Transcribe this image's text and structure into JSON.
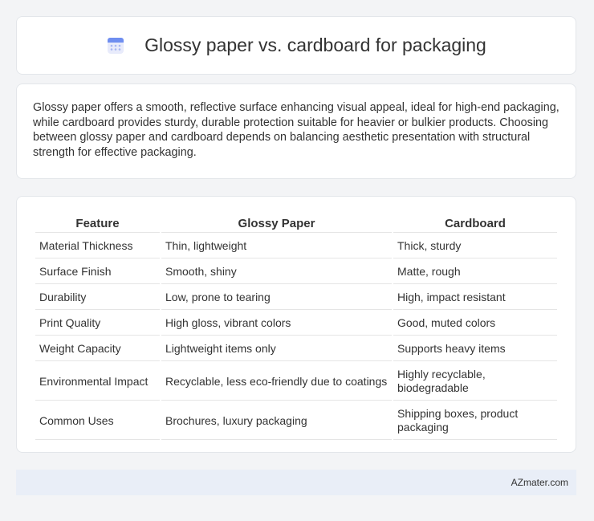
{
  "header": {
    "title": "Glossy paper vs. cardboard for packaging",
    "icon": "document-icon"
  },
  "intro": {
    "text": "Glossy paper offers a smooth, reflective surface enhancing visual appeal, ideal for high-end packaging, while cardboard provides sturdy, durable protection suitable for heavier or bulkier products. Choosing between glossy paper and cardboard depends on balancing aesthetic presentation with structural strength for effective packaging."
  },
  "table": {
    "headers": [
      "Feature",
      "Glossy Paper",
      "Cardboard"
    ],
    "rows": [
      [
        "Material Thickness",
        "Thin, lightweight",
        "Thick, sturdy"
      ],
      [
        "Surface Finish",
        "Smooth, shiny",
        "Matte, rough"
      ],
      [
        "Durability",
        "Low, prone to tearing",
        "High, impact resistant"
      ],
      [
        "Print Quality",
        "High gloss, vibrant colors",
        "Good, muted colors"
      ],
      [
        "Weight Capacity",
        "Lightweight items only",
        "Supports heavy items"
      ],
      [
        "Environmental Impact",
        "Recyclable, less eco-friendly due to coatings",
        "Highly recyclable, biodegradable"
      ],
      [
        "Common Uses",
        "Brochures, luxury packaging",
        "Shipping boxes, product packaging"
      ]
    ]
  },
  "footer": {
    "brand": "AZmater.com"
  }
}
